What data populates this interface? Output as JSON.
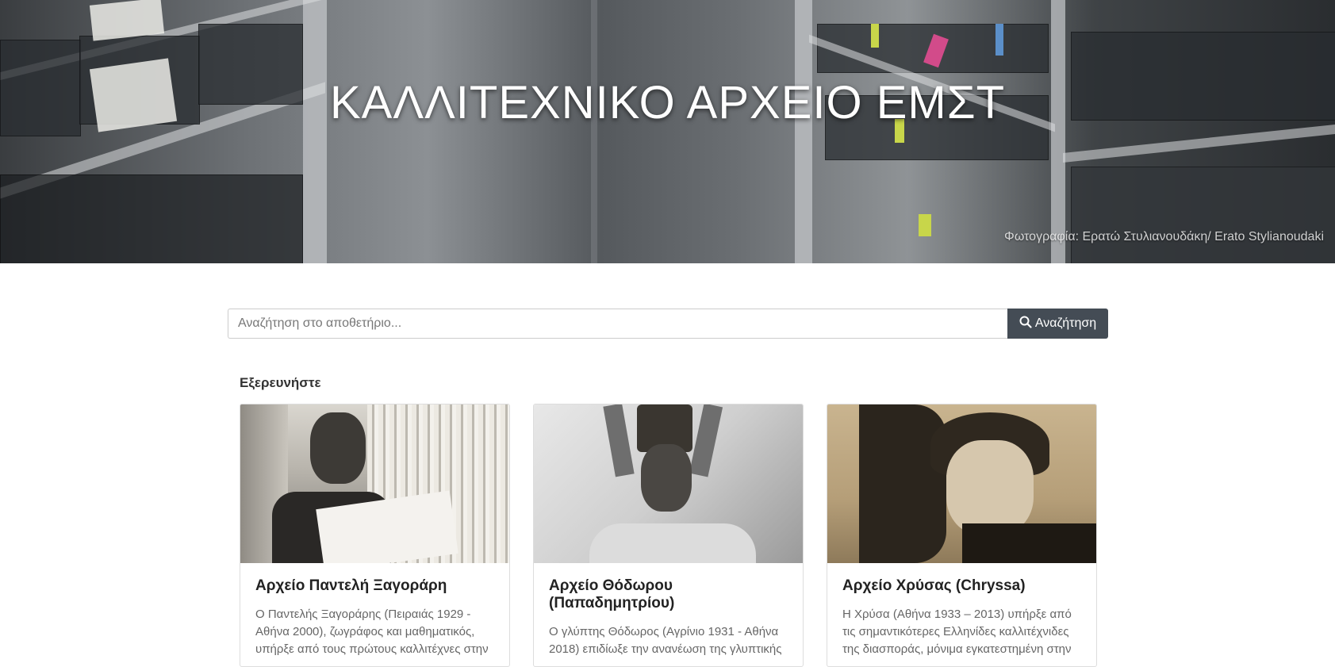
{
  "hero": {
    "title": "ΚΑΛΛΙΤΕΧΝΙΚΟ ΑΡΧΕΙΟ ΕΜΣΤ",
    "credit": "Φωτογραφία: Ερατώ Στυλιανουδάκη/ Erato Stylianoudaki"
  },
  "search": {
    "placeholder": "Αναζήτηση στο αποθετήριο...",
    "value": "",
    "button_label": "Αναζήτηση",
    "button_icon": "search-icon"
  },
  "explore": {
    "heading": "Εξερευνήστε",
    "cards": [
      {
        "title": "Αρχείο Παντελή Ξαγοράρη",
        "text": "Ο Παντελής Ξαγοράρης (Πειραιάς 1929 - Αθήνα 2000), ζωγράφος και μαθηματικός, υπήρξε από τους πρώτους καλλιτέχνες στην"
      },
      {
        "title": "Αρχείο Θόδωρου (Παπαδημητρίου)",
        "text": "Ο γλύπτης Θόδωρος (Αγρίνιο 1931 - Αθήνα 2018) επιδίωξε την ανανέωση της γλυπτικής"
      },
      {
        "title": "Αρχείο Χρύσας (Chryssa)",
        "text": "Η Χρύσα (Αθήνα 1933 – 2013) υπήρξε από τις σημαντικότερες Ελληνίδες καλλιτέχνιδες της διασποράς, μόνιμα εγκατεστημένη στην"
      }
    ]
  }
}
